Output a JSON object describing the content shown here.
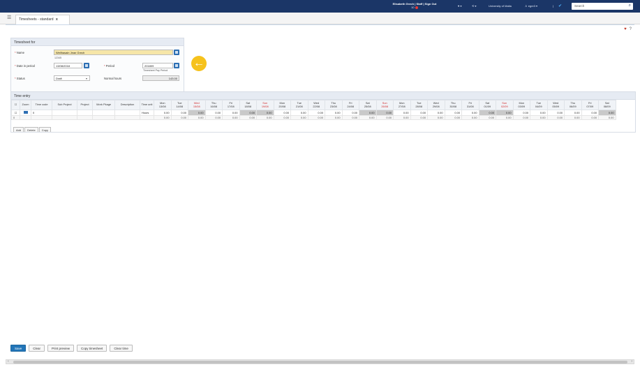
{
  "topbar": {
    "user_line1": "Elisabeth Grech | Staff | Sign Out",
    "user_line2": "10",
    "favorites_label": "♥ ▾",
    "history_label": "⟲ ▾",
    "org_label": "University of Malta",
    "account_label": "♙ egre3 ▾",
    "help_label": "|",
    "search_placeholder": "Search",
    "accent": "#1b3667"
  },
  "tab": {
    "label": "Timesheets - standard",
    "close": "x"
  },
  "timesheet_for": {
    "title": "Timesheet for",
    "name_label": "Name",
    "name_value": "Wellhasain Jean Grech",
    "name_sub": "12345",
    "date_label": "Date in period",
    "date_value": "13/08/2018",
    "period_label": "Period",
    "period_value": "201809",
    "period_sub": "Timesheet Pay Period",
    "status_label": "Status",
    "status_value": "Draft",
    "normal_hours_label": "Normal hours",
    "normal_hours_value": "143.00"
  },
  "time_entry": {
    "title": "Time entry",
    "col_headers": [
      "Zoom",
      "Time code",
      "Sub Project",
      "Project",
      "Work Pkage",
      "Description",
      "Time unit"
    ],
    "days": [
      {
        "day": "Mon",
        "date": "13/08",
        "weekend": false
      },
      {
        "day": "Tue",
        "date": "14/08",
        "weekend": false
      },
      {
        "day": "Wed",
        "date": "15/08",
        "weekend": true
      },
      {
        "day": "Thu",
        "date": "16/08",
        "weekend": false
      },
      {
        "day": "Fri",
        "date": "17/08",
        "weekend": false
      },
      {
        "day": "Sat",
        "date": "18/08",
        "weekend": false
      },
      {
        "day": "Sun",
        "date": "19/08",
        "weekend": true
      },
      {
        "day": "Mon",
        "date": "20/08",
        "weekend": false
      },
      {
        "day": "Tue",
        "date": "21/08",
        "weekend": false
      },
      {
        "day": "Wed",
        "date": "22/08",
        "weekend": false
      },
      {
        "day": "Thu",
        "date": "23/08",
        "weekend": false
      },
      {
        "day": "Fri",
        "date": "24/08",
        "weekend": false
      },
      {
        "day": "Sat",
        "date": "25/08",
        "weekend": false
      },
      {
        "day": "Sun",
        "date": "26/08",
        "weekend": true
      },
      {
        "day": "Mon",
        "date": "27/08",
        "weekend": false
      },
      {
        "day": "Tue",
        "date": "28/08",
        "weekend": false
      },
      {
        "day": "Wed",
        "date": "29/08",
        "weekend": false
      },
      {
        "day": "Thu",
        "date": "30/08",
        "weekend": false
      },
      {
        "day": "Fri",
        "date": "31/08",
        "weekend": false
      },
      {
        "day": "Sat",
        "date": "01/09",
        "weekend": false
      },
      {
        "day": "Sun",
        "date": "02/09",
        "weekend": true
      },
      {
        "day": "Mon",
        "date": "03/09",
        "weekend": false
      },
      {
        "day": "Tue",
        "date": "04/09",
        "weekend": false
      },
      {
        "day": "Wed",
        "date": "05/09",
        "weekend": false
      },
      {
        "day": "Thu",
        "date": "06/09",
        "weekend": false
      },
      {
        "day": "Fri",
        "date": "07/09",
        "weekend": false
      },
      {
        "day": "Sat",
        "date": "08/09",
        "weekend": false
      }
    ],
    "row": {
      "time_code": "0",
      "time_unit": "Hours",
      "values": [
        "0.00",
        "0.00",
        "0.00",
        "0.00",
        "0.00",
        "0.00",
        "0.00",
        "0.00",
        "0.00",
        "0.00",
        "0.00",
        "0.00",
        "0.00",
        "0.00",
        "0.00",
        "0.00",
        "0.00",
        "0.00",
        "0.00",
        "0.00",
        "0.00",
        "0.00",
        "0.00",
        "0.00",
        "0.00",
        "0.00",
        "0.00"
      ],
      "gray_index": [
        2,
        5,
        6,
        12,
        13,
        19,
        20,
        26
      ]
    },
    "sum_row": {
      "count": "0",
      "values": [
        "0.00",
        "0.00",
        "0.00",
        "0.00",
        "0.00",
        "0.00",
        "0.00",
        "0.00",
        "0.00",
        "0.00",
        "0.00",
        "0.00",
        "0.00",
        "0.00",
        "0.00",
        "0.00",
        "0.00",
        "0.00",
        "0.00",
        "0.00",
        "0.00",
        "0.00",
        "0.00",
        "0.00",
        "0.00",
        "0.00",
        "0.00"
      ]
    },
    "buttons": {
      "add": "Add",
      "delete": "Delete",
      "copy": "Copy"
    }
  },
  "bottom": {
    "save": "Save",
    "clear": "Clear",
    "print_preview": "Print preview",
    "copy_timesheet": "Copy timesheet",
    "clear_time": "Clear time"
  }
}
